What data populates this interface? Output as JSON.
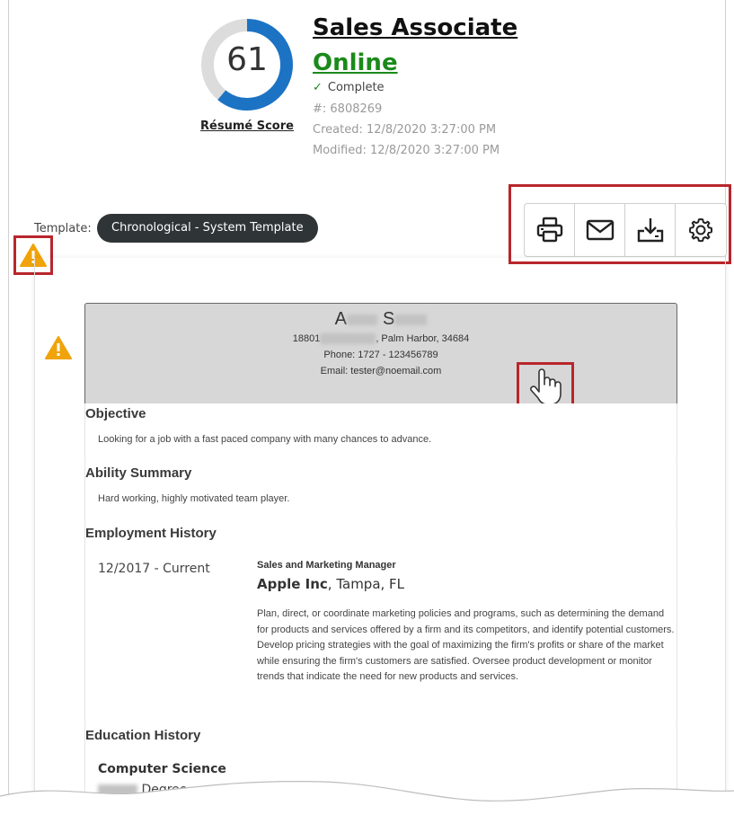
{
  "header": {
    "score": "61",
    "score_fraction": 0.61,
    "score_label": "Résumé Score",
    "title": "Sales Associate",
    "status": "Online",
    "completion": "Complete",
    "number": "#: 6808269",
    "created": "Created: 12/8/2020 3:27:00 PM",
    "modified": "Modified: 12/8/2020 3:27:00 PM"
  },
  "template": {
    "label": "Template:",
    "name": "Chronological - System Template"
  },
  "toolbar": {
    "buttons": [
      "printer-icon",
      "envelope-icon",
      "download-icon",
      "gear-icon"
    ]
  },
  "resume": {
    "name_initial_first": "A",
    "name_initial_last": "S",
    "address_start": "18801",
    "address_end": ", Palm Harbor, 34684",
    "phone": "Phone: 1727 - 123456789",
    "email": "Email: tester@noemail.com",
    "sections": {
      "objective": {
        "title": "Objective",
        "text": "Looking for a job with a fast paced company with many chances to advance."
      },
      "ability": {
        "title": "Ability Summary",
        "text": "Hard working, highly motivated team player."
      },
      "employment": {
        "title": "Employment History",
        "date": "12/2017 - Current",
        "role": "Sales and Marketing Manager",
        "company": "Apple Inc",
        "location": ", Tampa, FL",
        "description": "Plan, direct, or coordinate marketing policies and programs, such as determining the demand for products and services offered by a firm and its competitors, and identify potential customers. Develop pricing strategies with the goal of maximizing the firm's profits or share of the market while ensuring the firm's customers are satisfied. Oversee product development or monitor trends that indicate the need for new products and services."
      },
      "education": {
        "title": "Education History",
        "field": "Computer Science",
        "degree": "Degree"
      }
    }
  },
  "colors": {
    "ring": "#1c73c4",
    "ring_track": "#dcdcdc",
    "status_green": "#1a8a1a",
    "highlight_red": "#b8262b",
    "warning_orange": "#f0a30a",
    "pill_dark": "#2f3437"
  }
}
